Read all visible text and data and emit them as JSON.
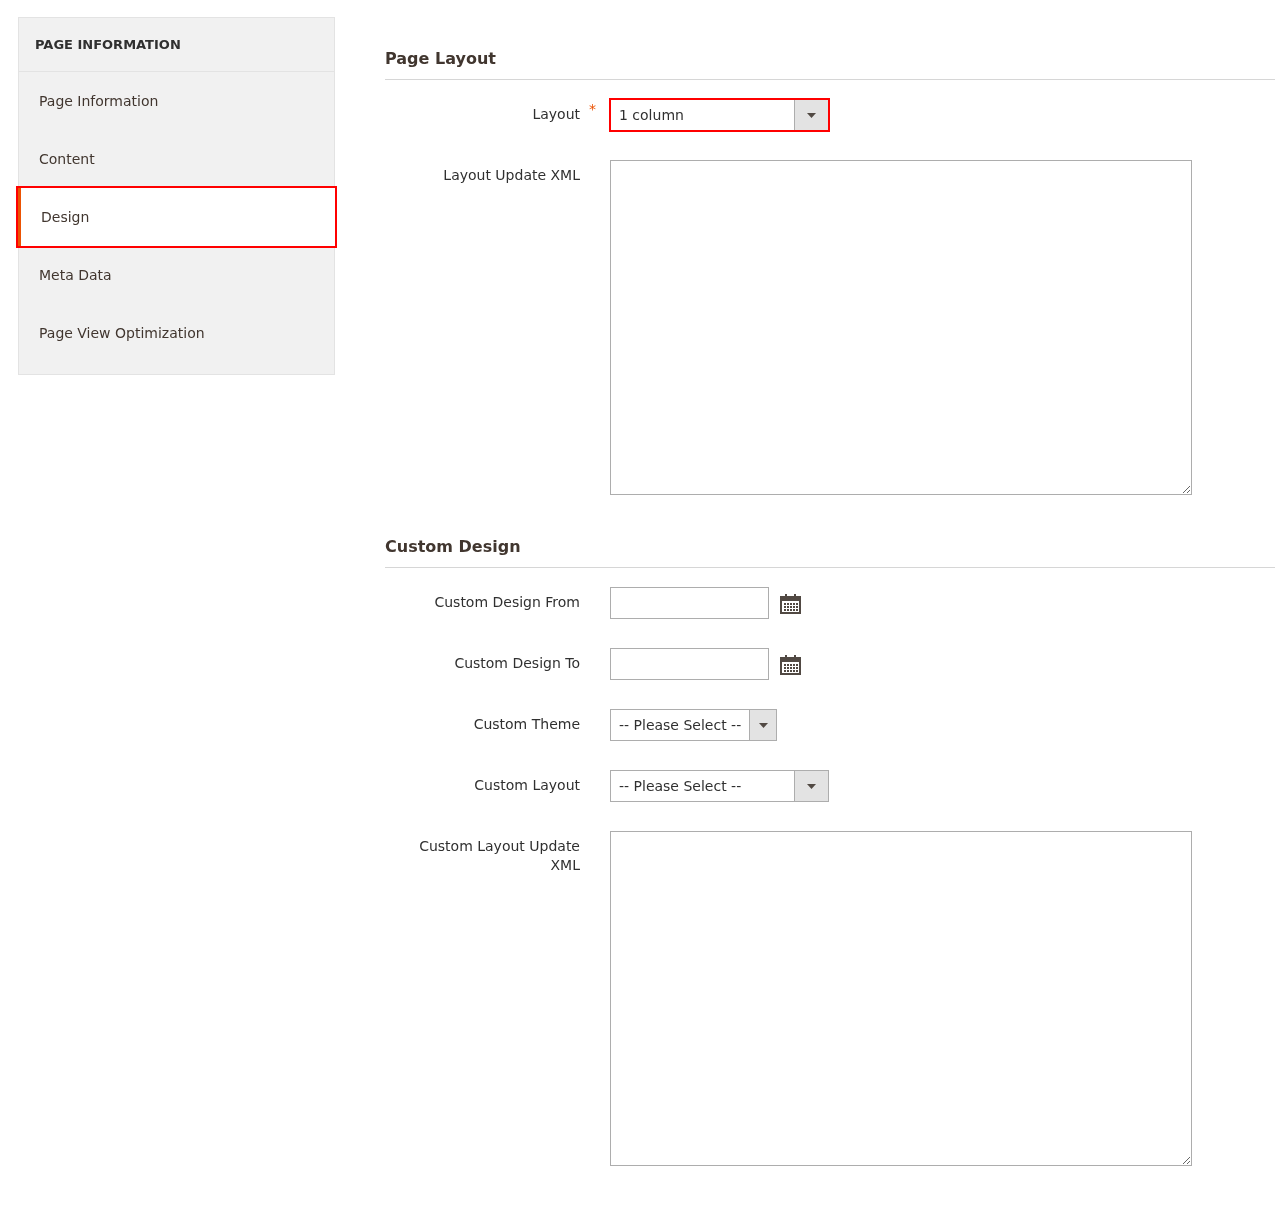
{
  "sidebar": {
    "title": "PAGE INFORMATION",
    "items": [
      {
        "label": "Page Information",
        "selected": false,
        "highlighted": false
      },
      {
        "label": "Content",
        "selected": false,
        "highlighted": false
      },
      {
        "label": "Design",
        "selected": true,
        "highlighted": true
      },
      {
        "label": "Meta Data",
        "selected": false,
        "highlighted": false
      },
      {
        "label": "Page View Optimization",
        "selected": false,
        "highlighted": false
      }
    ]
  },
  "sections": [
    {
      "title": "Page Layout",
      "fields": [
        {
          "kind": "select",
          "label": "Layout",
          "required_mark": "*",
          "value": "1 column",
          "highlighted": true
        },
        {
          "kind": "textarea",
          "label": "Layout Update XML"
        }
      ]
    },
    {
      "title": "Custom Design",
      "fields": [
        {
          "kind": "date",
          "label": "Custom Design From"
        },
        {
          "kind": "date",
          "label": "Custom Design To"
        },
        {
          "kind": "short-select",
          "label": "Custom Theme",
          "value": "-- Please Select --",
          "highlighted": false
        },
        {
          "kind": "select",
          "label": "Custom Layout",
          "value": "-- Please Select --",
          "highlighted": false
        },
        {
          "kind": "textarea",
          "label": "Custom Layout Update XML"
        }
      ]
    }
  ]
}
